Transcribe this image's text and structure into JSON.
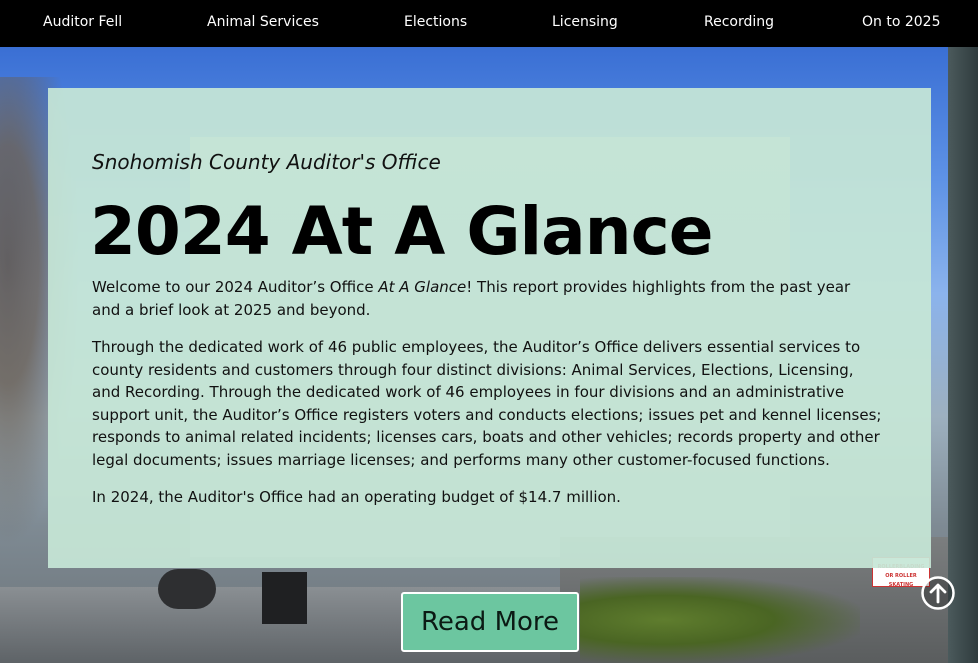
{
  "nav": {
    "items": [
      {
        "label": "Auditor Fell"
      },
      {
        "label": "Animal Services"
      },
      {
        "label": "Elections"
      },
      {
        "label": "Licensing"
      },
      {
        "label": "Recording"
      },
      {
        "label": "On to 2025"
      }
    ]
  },
  "background": {
    "sign_text": "ROLLERBLADING OR ROLLER SKATING"
  },
  "hero": {
    "org_name": "Snohomish County Auditor's Office",
    "title": "2024 At A Glance",
    "intro_before": "Welcome to our 2024 Auditor’s Office ",
    "intro_emphasis": "At A Glance",
    "intro_after": "! This report provides highlights from the past year and a brief look at 2025 and beyond.",
    "paragraph2": "Through the dedicated work of 46 public employees, the Auditor’s Office delivers essential services to county residents and customers through four distinct divisions: Animal Services, Elections, Licensing, and Recording. Through the dedicated work of 46 employees in four divisions and an administrative support unit, the Auditor’s Office registers voters and conducts elections; issues pet and kennel licenses; responds to animal related incidents; licenses cars, boats and other vehicles; records property and other legal documents; issues marriage licenses; and performs many other customer-focused functions.",
    "paragraph3": "In 2024, the Auditor's Office had an operating budget of $14.7 million.",
    "read_more_label": "Read More"
  },
  "icons": {
    "back_to_top": "arrow-up-circle-icon"
  },
  "colors": {
    "nav_bg": "#000000",
    "panel_bg": "#c6e6d6",
    "button_bg": "#6cc6a0"
  }
}
